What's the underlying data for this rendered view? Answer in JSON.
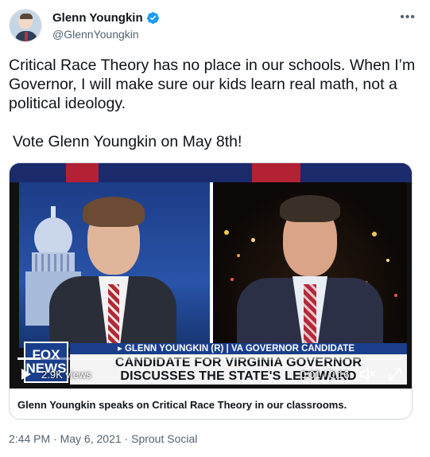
{
  "tweet": {
    "author": {
      "display_name": "Glenn Youngkin",
      "handle": "@GlennYoungkin",
      "verified": true
    },
    "text_lines": [
      "Critical Race Theory has no place in our schools. When I’m Governor, I will make sure our kids learn real math, not a political ideology.",
      "Vote Glenn Youngkin on May 8th!"
    ],
    "media": {
      "lower_third_name": "▸ GLENN YOUNGKIN (R)  |  VA GOVERNOR CANDIDATE",
      "headline_line1": "CANDIDATE FOR VIRGINIA GOVERNOR",
      "headline_line2": "DISCUSSES THE STATE'S LEFTWARD",
      "network_logo_line1": "FOX",
      "network_logo_line2": "NEWS",
      "views": "2.9K views",
      "time_current": "0:01",
      "time_separator": " / ",
      "time_total": "0:16",
      "progress": 0.06,
      "card_title": "Glenn Youngkin speaks on Critical Race Theory in our classrooms."
    },
    "meta": {
      "time": "2:44 PM",
      "separator": " · ",
      "date": "May 6, 2021",
      "source": "Sprout Social"
    }
  },
  "icons": {
    "more": "more-icon",
    "verified": "verified-badge-icon",
    "play": "play-icon",
    "mute": "mute-icon",
    "fullscreen": "fullscreen-icon"
  },
  "colors": {
    "verified_blue": "#1d9bf0",
    "secondary_text": "#536471",
    "fox_blue": "#1a3e8c"
  }
}
